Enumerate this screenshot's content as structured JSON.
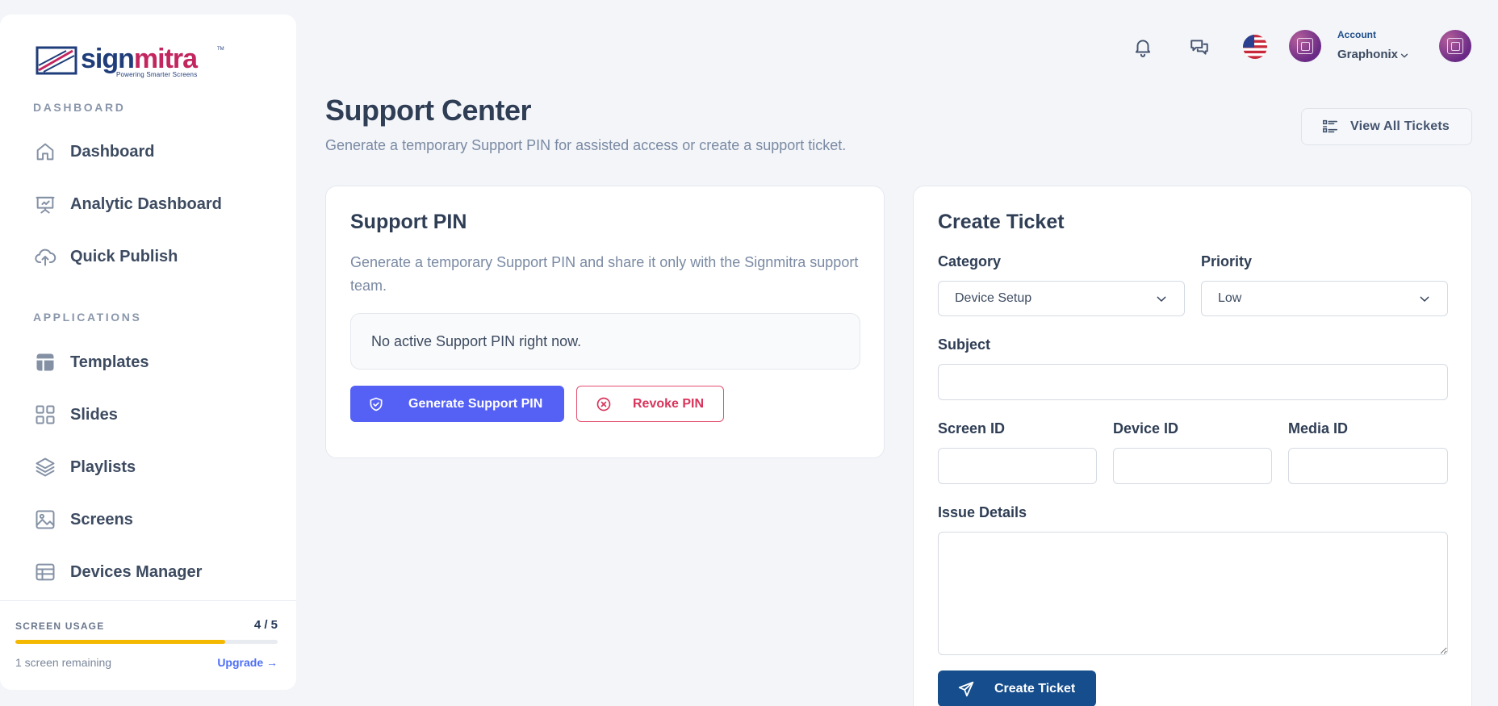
{
  "brand": {
    "name_part1": "sign",
    "name_part2": "mitra",
    "tagline": "Powering Smarter Screens",
    "trademark": "TM",
    "primary_color": "#1f3d7a",
    "accent_color": "#c3265f"
  },
  "sidebar": {
    "sections": [
      {
        "label": "DASHBOARD",
        "items": [
          {
            "label": "Dashboard",
            "icon": "home-icon"
          },
          {
            "label": "Analytic Dashboard",
            "icon": "presentation-chart-icon"
          },
          {
            "label": "Quick Publish",
            "icon": "cloud-upload-icon"
          }
        ]
      },
      {
        "label": "APPLICATIONS",
        "items": [
          {
            "label": "Templates",
            "icon": "layout-icon"
          },
          {
            "label": "Slides",
            "icon": "grid-icon"
          },
          {
            "label": "Playlists",
            "icon": "layers-icon"
          },
          {
            "label": "Screens",
            "icon": "image-icon"
          },
          {
            "label": "Devices Manager",
            "icon": "table-icon"
          }
        ]
      }
    ],
    "usage": {
      "title": "SCREEN USAGE",
      "count": "4 / 5",
      "used": 4,
      "total": 5,
      "remaining": "1 screen remaining",
      "upgrade": "Upgrade →",
      "bar_color": "#f5b800"
    }
  },
  "header": {
    "icons": [
      "bell-icon",
      "chat-icon",
      "us-flag-icon"
    ],
    "account_label": "Account",
    "account_name": "Graphonix"
  },
  "page": {
    "title": "Support Center",
    "subtitle": "Generate a temporary Support PIN for assisted access or create a support ticket.",
    "view_all_button": "View All Tickets"
  },
  "support_pin": {
    "title": "Support PIN",
    "description": "Generate a temporary Support PIN and share it only with the Signmitra support team.",
    "status": "No active Support PIN right now.",
    "generate_button": "Generate Support PIN",
    "revoke_button": "Revoke PIN",
    "generate_color": "#5561f5",
    "revoke_color": "#d8345b"
  },
  "ticket": {
    "title": "Create Ticket",
    "category_label": "Category",
    "category_value": "Device Setup",
    "priority_label": "Priority",
    "priority_value": "Low",
    "subject_label": "Subject",
    "subject_value": "",
    "screen_id_label": "Screen ID",
    "device_id_label": "Device ID",
    "media_id_label": "Media ID",
    "issue_label": "Issue Details",
    "submit_button": "Create Ticket",
    "submit_color": "#164d8c"
  }
}
